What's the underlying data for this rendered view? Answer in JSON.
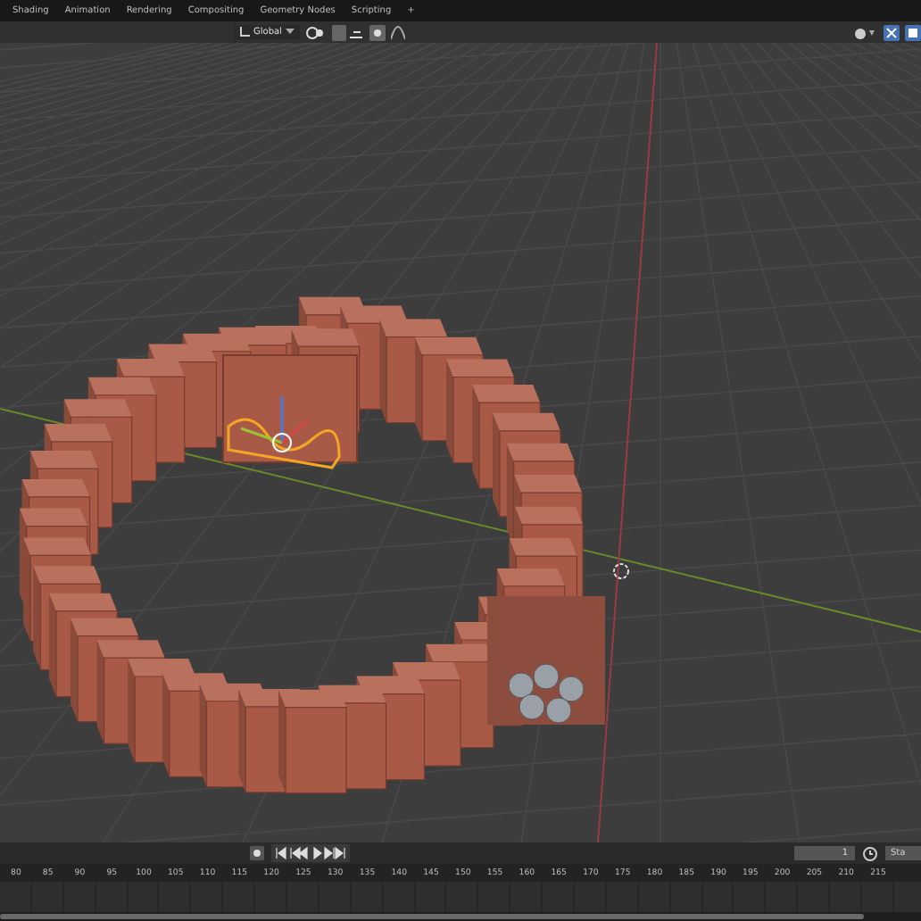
{
  "workspace_tabs": [
    {
      "label": "Shading",
      "selected": false
    },
    {
      "label": "Animation",
      "selected": false
    },
    {
      "label": "Rendering",
      "selected": false
    },
    {
      "label": "Compositing",
      "selected": false
    },
    {
      "label": "Geometry Nodes",
      "selected": false
    },
    {
      "label": "Scripting",
      "selected": false
    }
  ],
  "add_tab": "+",
  "viewport_header": {
    "orientation": "Global"
  },
  "timeline": {
    "current_frame": "1",
    "start_label": "Sta",
    "ruler": [
      "80",
      "85",
      "90",
      "95",
      "100",
      "105",
      "110",
      "115",
      "120",
      "125",
      "130",
      "135",
      "140",
      "145",
      "150",
      "155",
      "160",
      "165",
      "170",
      "175",
      "180",
      "185",
      "190",
      "195",
      "200",
      "205",
      "210",
      "215"
    ]
  }
}
